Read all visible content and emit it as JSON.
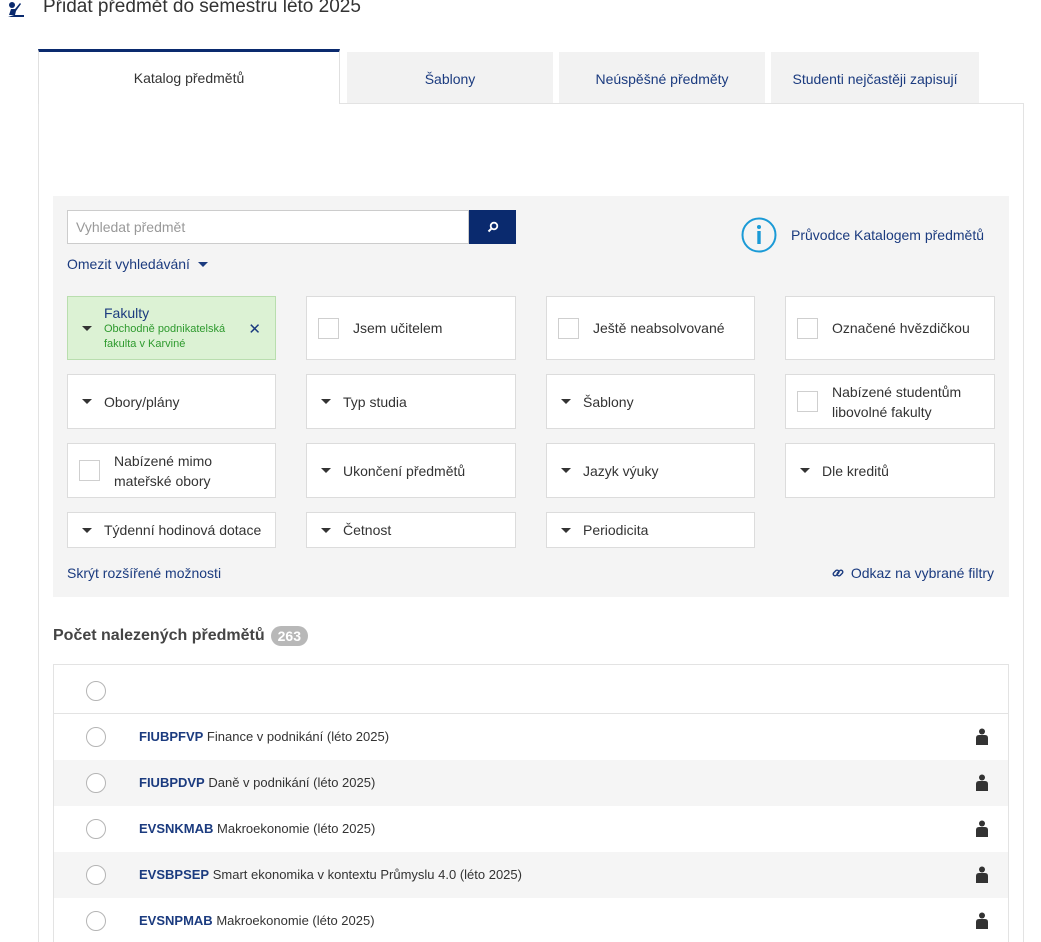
{
  "header": {
    "title": "Přidat předmět do semestru léto 2025",
    "icon": "teacher-icon"
  },
  "tabs": [
    {
      "label": "Katalog předmětů",
      "active": true
    },
    {
      "label": "Šablony",
      "active": false
    },
    {
      "label": "Neúspěšné předměty",
      "active": false
    },
    {
      "label": "Studenti nejčastěji zapisují",
      "active": false
    }
  ],
  "search": {
    "placeholder": "Vyhledat předmět",
    "value": ""
  },
  "guide": {
    "label": "Průvodce Katalogem předmětů"
  },
  "refine_label": "Omezit vyhledávání",
  "filters": {
    "faculty": {
      "title": "Fakulty",
      "line1": "Obchodně podnikatelská",
      "line2": "fakulta v Karviné",
      "remove": "✕"
    },
    "teacher": "Jsem učitelem",
    "not_completed": "Ještě neabsolvované",
    "starred": "Označené hvězdičkou",
    "programs": "Obory/plány",
    "study_type": "Typ studia",
    "templates": "Šablony",
    "any_faculty_line1": "Nabízené studentům",
    "any_faculty_line2": "libovolné fakulty",
    "outside_line1": "Nabízené mimo",
    "outside_line2": "mateřské obory",
    "completion": "Ukončení předmětů",
    "language": "Jazyk výuky",
    "credits": "Dle kreditů",
    "weekly_hours": "Týdenní hodinová dotace",
    "frequency": "Četnost",
    "periodicity": "Periodicita"
  },
  "hide_advanced": "Skrýt rozšířené možnosti",
  "link_filters": "Odkaz na vybrané filtry",
  "results": {
    "label": "Počet nalezených předmětů",
    "count": "263",
    "rows": [
      {
        "code": "FIUBPFVP",
        "name": "Finance v podnikání (léto 2025)"
      },
      {
        "code": "FIUBPDVP",
        "name": "Daně v podnikání (léto 2025)"
      },
      {
        "code": "EVSNKMAB",
        "name": "Makroekonomie (léto 2025)"
      },
      {
        "code": "EVSBPSEP",
        "name": "Smart ekonomika v kontextu Průmyslu 4.0 (léto 2025)"
      },
      {
        "code": "EVSNPMAB",
        "name": "Makroekonomie (léto 2025)"
      }
    ]
  },
  "colors": {
    "primary": "#0a2a6e",
    "link": "#1b3b7f",
    "faculty_bg": "#dcf2d4",
    "faculty_text": "#2e9a2e",
    "info_icon": "#1a9ad6"
  }
}
